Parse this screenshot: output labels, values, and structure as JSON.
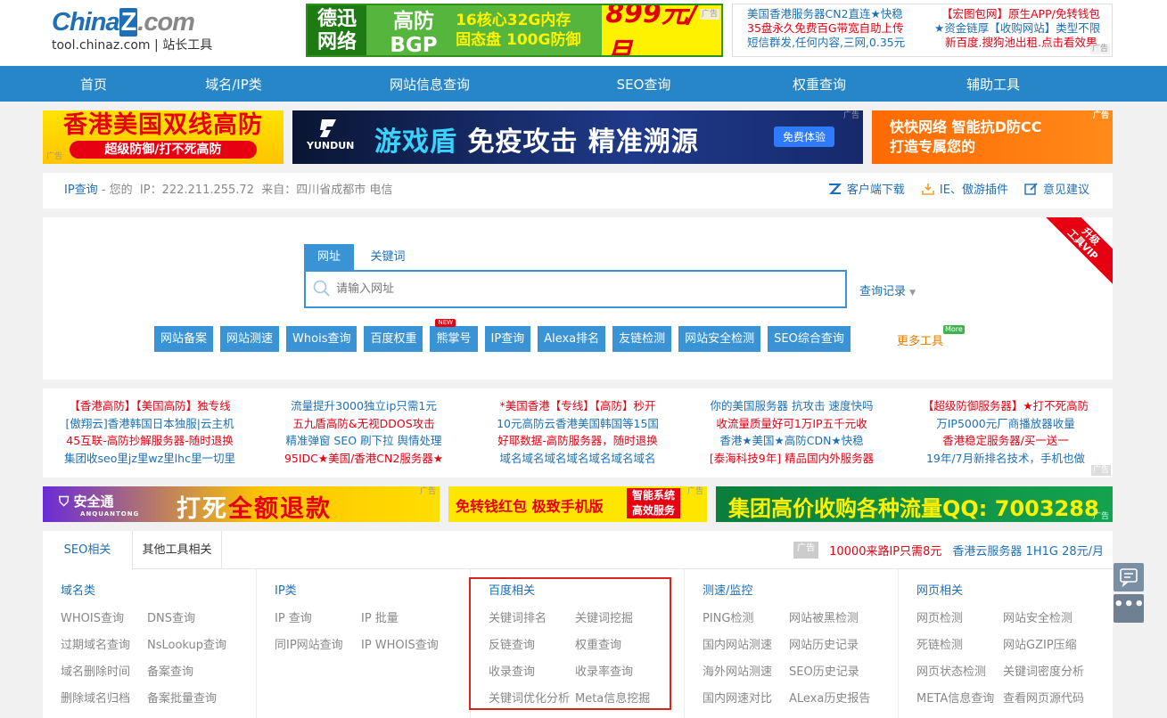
{
  "header": {
    "logo_brand_pre": "China",
    "logo_brand_z": "Z",
    "logo_brand_post": ".com",
    "logo_sub": "tool.chinaz.com | 站长工具",
    "ad_top": {
      "logo": "德迅网络",
      "t1": "高防BGP",
      "t2a": "16核心32G内存",
      "t2b": "固态盘 100G防御",
      "price": "899元/月",
      "tag": "广告"
    },
    "ad_text": [
      [
        "美国香港服务器CN2直连★快稳",
        "【宏图包网】原生APP/免转钱包"
      ],
      [
        "35盘永久免费百G带宽自助上传",
        "★资金链厚【收购网站】类型不限"
      ],
      [
        "短信群发,任何内容,三网,0.35元",
        "新百度.搜狗池出租.点击看效果"
      ]
    ],
    "ad_text_tag": "广告"
  },
  "nav": [
    "首页",
    "域名/IP类",
    "网站信息查询",
    "SEO查询",
    "权重查询",
    "辅助工具"
  ],
  "banners": {
    "b1_title": "香港美国双线高防",
    "b1_sub": "超级防御/打不死高防",
    "b2_brand": "YUNDUN",
    "b2_main_a": "游戏盾",
    "b2_main_b": " 免疫攻击 精准溯源",
    "b2_btn": "免费体验",
    "b3_a": "快快网络  智能抗D防CC",
    "b3_b": "打造专属您的",
    "b4_logo": "安全通",
    "b4_logo_sub": "ANQUANTONG",
    "b4_a": "打死",
    "b4_b": "全额退款",
    "b5_main": "免转钱红包 极致手机版",
    "b5_s1": "智能系统",
    "b5_s2": "高效服务",
    "b6_main": "集团高价收购各种流量QQ: 7003288",
    "tag": "广告"
  },
  "infobar": {
    "ip_query": "IP查询",
    "yours": " - 您的",
    "ip_label": "IP：222.211.255.72",
    "from": "来自：四川省成都市 电信",
    "client": "客户端下载",
    "plugin": "IE、傲游插件",
    "feedback": "意见建议"
  },
  "search": {
    "tab_url": "网址",
    "tab_kw": "关键词",
    "placeholder": "请输入网址",
    "history": "查询记录",
    "vip_a": "升级",
    "vip_b": "工具VIP",
    "new_tag": "NEW",
    "more": "更多工具",
    "more_tag": "More",
    "quick": [
      "网站备案",
      "网站测速",
      "Whois查询",
      "百度权重",
      "熊掌号",
      "IP查询",
      "Alexa排名",
      "友链检测",
      "网站安全检测",
      "SEO综合查询"
    ]
  },
  "text_ads": [
    {
      "items": [
        "【香港高防】【美国高防】独专线",
        "[傲翔云]香港韩国日本独服|云主机",
        "45互联-高防抄解服务器-随时退换",
        "集团收seo里jz里wz里lhc里一切里"
      ],
      "colors": [
        "#e60012",
        "#1e6fb6",
        "#e60012",
        "#1e6fb6"
      ]
    },
    {
      "items": [
        "流量提升3000独立ip只需1元",
        "五九盾高防&无视DDOS攻击",
        "精准弹窗 SEO 刷下拉 舆情处理",
        "95IDC★美国/香港CN2服务器★"
      ],
      "colors": [
        "#1e6fb6",
        "#e60012",
        "#1e6fb6",
        "#e60012"
      ]
    },
    {
      "items": [
        "*美国香港【专线】【高防】秒开",
        "10元高防云香港美国韩国等15国",
        "好耶数据-高防服务器，随时退换",
        "域名域名域名域名域名域名域名"
      ],
      "colors": [
        "#e60012",
        "#1e6fb6",
        "#e60012",
        "#1e6fb6"
      ]
    },
    {
      "items": [
        "你的美国服务器 抗攻击 速度快吗",
        "收流量质量好可1万IP五千元收",
        "香港★美国★高防CDN★快稳",
        "[泰海科技9年] 精品国内外服务器"
      ],
      "colors": [
        "#1e6fb6",
        "#e60012",
        "#1e6fb6",
        "#e60012"
      ]
    },
    {
      "items": [
        "【超级防御服务器】★打不死高防",
        "万IP5000元厂商播放器收量",
        "香港稳定服务器/买一送一",
        "19年/7月新排名技术，手机也做"
      ],
      "colors": [
        "#e60012",
        "#1e6fb6",
        "#e60012",
        "#1e6fb6"
      ]
    }
  ],
  "text_ads_tag": "广告",
  "tools": {
    "tab_seo": "SEO相关",
    "tab_other": "其他工具相关",
    "ad_tag": "广告",
    "ad1": "10000来路IP只需8元",
    "ad2": "香港云服务器 1H1G 28元/月",
    "cols": [
      {
        "title": "域名类",
        "items": [
          "WHOIS查询",
          "DNS查询",
          "过期域名查询",
          "NsLookup查询",
          "域名删除时间",
          "备案查询",
          "删除域名归档",
          "备案批量查询"
        ]
      },
      {
        "title": "IP类",
        "items": [
          "IP 查询",
          "IP 批量",
          "同IP网站查询",
          "IP WHOIS查询"
        ]
      },
      {
        "title": "百度相关",
        "items": [
          "关键词排名",
          "关键词挖掘",
          "反链查询",
          "权重查询",
          "收录查询",
          "收录率查询",
          "关键词优化分析",
          "Meta信息挖掘"
        ]
      },
      {
        "title": "测速/监控",
        "items": [
          "PING检测",
          "网站被黑检测",
          "国内网站测速",
          "网站历史记录",
          "海外网站测速",
          "SEO历史记录",
          "国内网速对比",
          "ALexa历史报告"
        ]
      },
      {
        "title": "网页相关",
        "items": [
          "网页检测",
          "网站安全检测",
          "死链检测",
          "网站GZIP压缩",
          "网页状态检测",
          "关键词密度分析",
          "META信息查询",
          "查看网页源代码"
        ]
      }
    ]
  },
  "float": {
    "more": "•••"
  },
  "colors": {
    "blue": "#2686c7",
    "link": "#1e6fb6",
    "red": "#e60012"
  }
}
